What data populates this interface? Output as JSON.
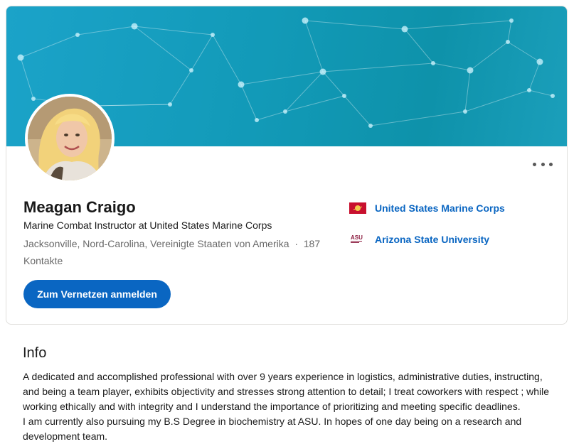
{
  "profile": {
    "name": "Meagan Craigo",
    "headline": "Marine Combat Instructor at United States Marine Corps",
    "location": "Jacksonville, Nord-Carolina, Vereinigte Staaten von Amerika",
    "separator": "·",
    "connections": "187 Kontakte",
    "connect_label": "Zum Vernetzen anmelden",
    "more_icon": "more-icon"
  },
  "organizations": [
    {
      "name": "United States Marine Corps",
      "logo": "usmc-logo"
    },
    {
      "name": "Arizona State University",
      "logo": "asu-logo",
      "logo_text": "ASU"
    }
  ],
  "info": {
    "title": "Info",
    "paragraph1": "A dedicated and accomplished professional with over 9 years experience in logistics, administrative duties, instructing, and being a team player, exhibits objectivity and stresses strong attention to detail; I treat coworkers with respect ; while working ethically and with integrity and I understand the importance of prioritizing and meeting specific deadlines.",
    "paragraph2": "I am currently also pursuing my B.S Degree in biochemistry at ASU. In hopes of one day being on a research and development team."
  },
  "colors": {
    "accent": "#0a66c2",
    "banner": "#129ab8"
  }
}
